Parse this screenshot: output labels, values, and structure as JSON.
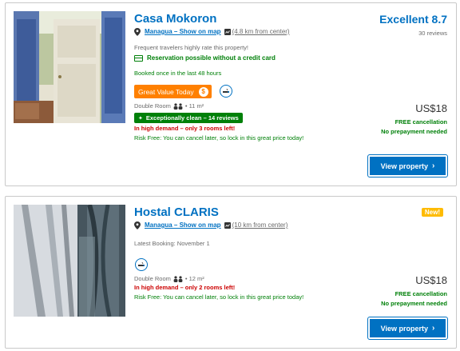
{
  "properties": [
    {
      "name": "Casa Mokoron",
      "location_link": "Managua – Show on map",
      "distance": "(4.8 km from center)",
      "traveler_note": "Frequent travelers highly rate this property!",
      "no_credit_card": "Reservation possible without a credit card",
      "booked_note": "Booked once in the last 48 hours",
      "good_value": "Great Value Today",
      "room_type": "Double Room",
      "room_size": "• 11 m²",
      "clean_badge": "Exceptionally clean – 14 reviews",
      "demand": "In high demand – only 3 rooms left!",
      "risk_free": "Risk Free: You can cancel later, so lock in this great price today!",
      "score_text": "Excellent 8.7",
      "reviews": "30 reviews",
      "price": "US$18",
      "free_cancel": "FREE cancellation",
      "no_prepay": "No prepayment needed",
      "cta": "View property",
      "icons": [
        "map-pin-icon",
        "map-icon",
        "credit-card-icon",
        "dollar-circle-icon",
        "no-smoking-icon",
        "two-persons-icon",
        "sparkle-icon",
        "chevron-right-icon"
      ]
    },
    {
      "name": "Hostal CLARIS",
      "location_link": "Managua – Show on map",
      "distance": "(10 km from center)",
      "latest_booking": "Latest Booking: November 1",
      "room_type": "Double Room",
      "room_size": "• 12 m²",
      "demand": "In high demand – only 2 rooms left!",
      "risk_free": "Risk Free: You can cancel later, so lock in this great price today!",
      "badge": "New!",
      "price": "US$18",
      "free_cancel": "FREE cancellation",
      "no_prepay": "No prepayment needed",
      "cta": "View property",
      "icons": [
        "map-pin-icon",
        "map-icon",
        "no-smoking-icon",
        "two-persons-icon",
        "chevron-right-icon"
      ]
    }
  ],
  "colors": {
    "link_blue": "#0071c2",
    "green": "#008009",
    "orange": "#ff8000",
    "red": "#cc0000",
    "new_badge": "#febb02"
  }
}
